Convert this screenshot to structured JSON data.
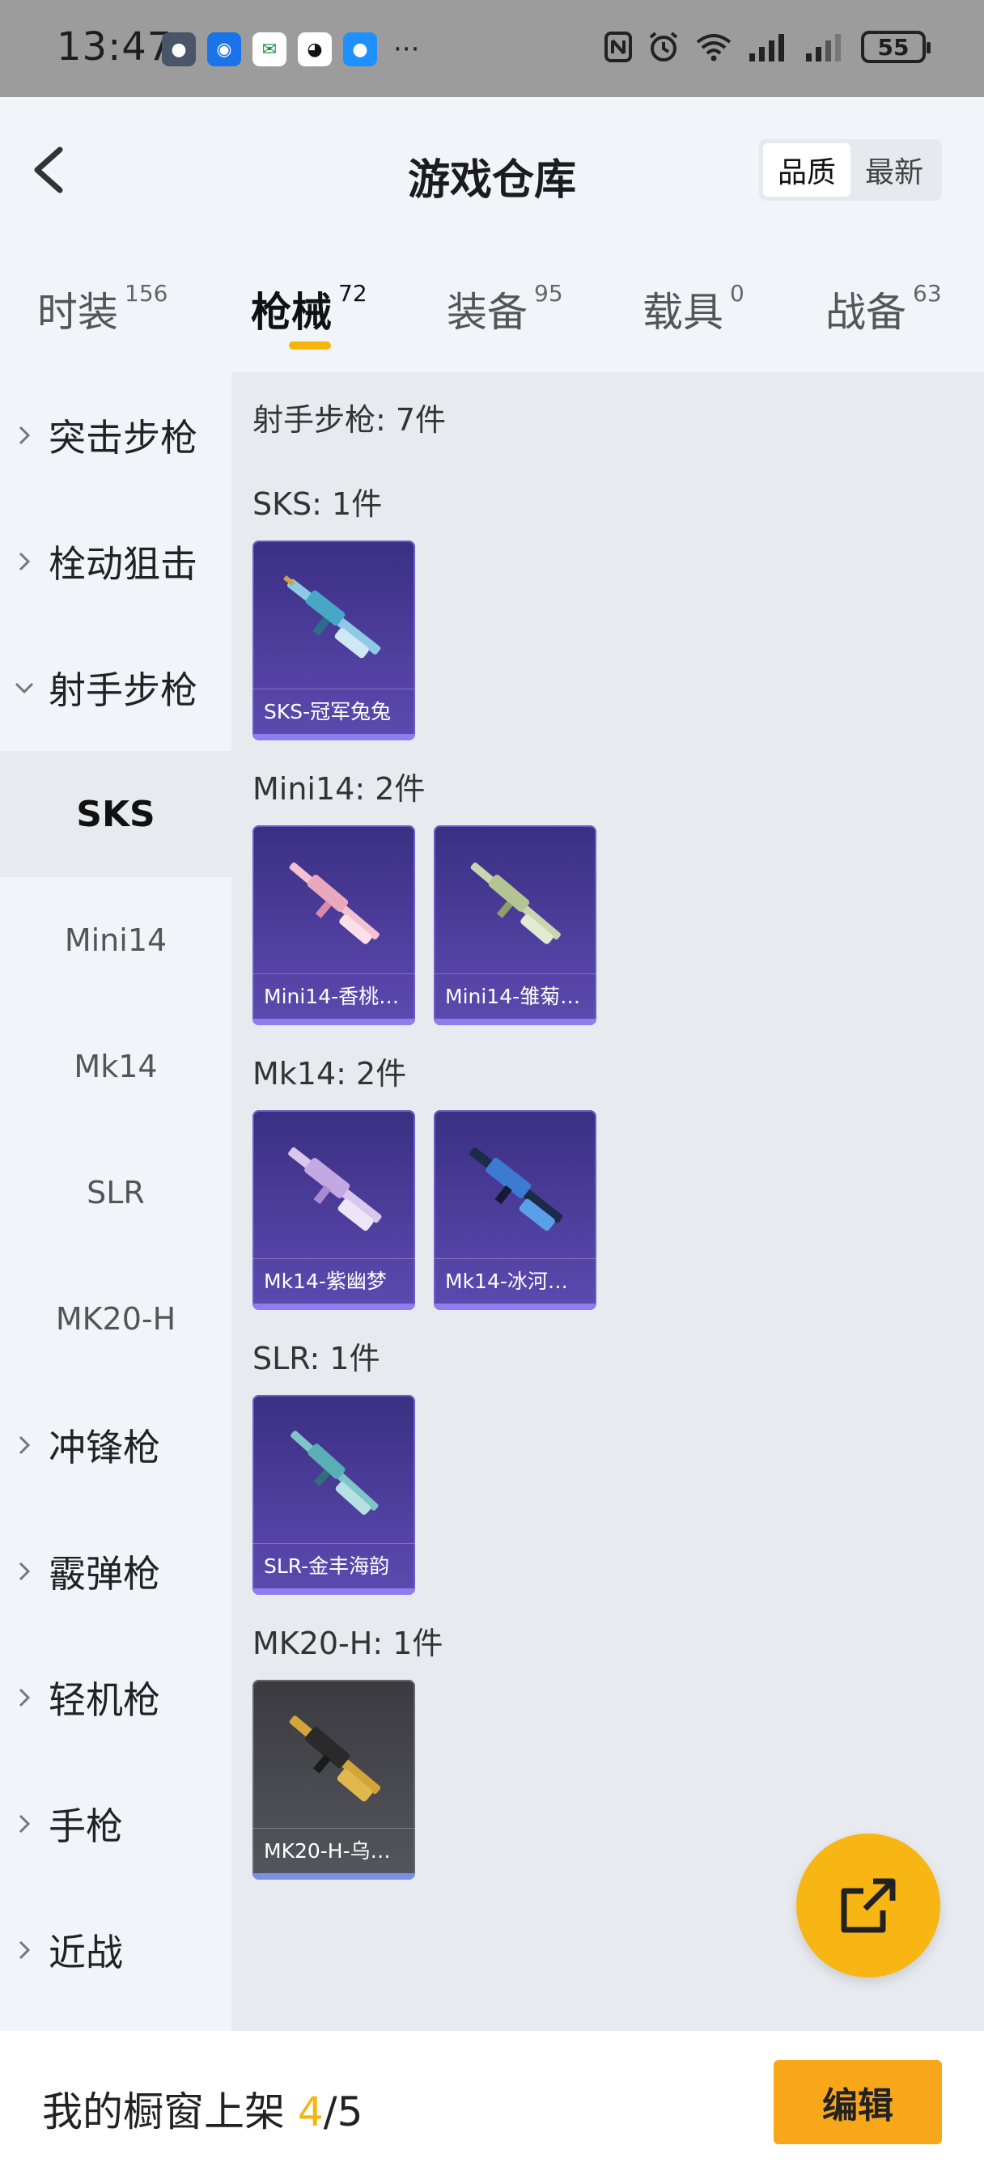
{
  "status_bar": {
    "time": "13:47",
    "battery": "55",
    "more": "···"
  },
  "header": {
    "title": "游戏仓库",
    "sort_options": [
      "品质",
      "最新"
    ],
    "active_sort": "品质"
  },
  "tabs": [
    {
      "label": "时装",
      "count": "156"
    },
    {
      "label": "枪械",
      "count": "72"
    },
    {
      "label": "装备",
      "count": "95"
    },
    {
      "label": "载具",
      "count": "0"
    },
    {
      "label": "战备",
      "count": "63"
    }
  ],
  "sidebar": {
    "categories": [
      {
        "label": "突击步枪",
        "expanded": false
      },
      {
        "label": "栓动狙击",
        "expanded": false
      },
      {
        "label": "射手步枪",
        "expanded": true
      },
      {
        "label": "冲锋枪",
        "expanded": false
      },
      {
        "label": "霰弹枪",
        "expanded": false
      },
      {
        "label": "轻机枪",
        "expanded": false
      },
      {
        "label": "手枪",
        "expanded": false
      },
      {
        "label": "近战",
        "expanded": false
      }
    ],
    "subitems": [
      "SKS",
      "Mini14",
      "Mk14",
      "SLR",
      "MK20-H"
    ],
    "active_subitem": "SKS"
  },
  "content": {
    "header": "射手步枪: 7件",
    "groups": [
      {
        "title": "SKS: 1件",
        "items": [
          {
            "name": "SKS-冠军兔兔",
            "color": "purple"
          }
        ]
      },
      {
        "title": "Mini14: 2件",
        "items": [
          {
            "name": "Mini14-香桃…",
            "color": "purple"
          },
          {
            "name": "Mini14-雏菊…",
            "color": "purple"
          }
        ]
      },
      {
        "title": "Mk14: 2件",
        "items": [
          {
            "name": "Mk14-紫幽梦",
            "color": "purple"
          },
          {
            "name": "Mk14-冰河…",
            "color": "purple"
          }
        ]
      },
      {
        "title": "SLR: 1件",
        "items": [
          {
            "name": "SLR-金丰海韵",
            "color": "purple"
          }
        ]
      },
      {
        "title": "MK20-H: 1件",
        "items": [
          {
            "name": "MK20-H-乌…",
            "color": "gray"
          }
        ]
      }
    ]
  },
  "bottom_bar": {
    "shelf_label": "我的橱窗上架",
    "shelf_current": "4",
    "shelf_total": "/5",
    "edit_label": "编辑"
  }
}
